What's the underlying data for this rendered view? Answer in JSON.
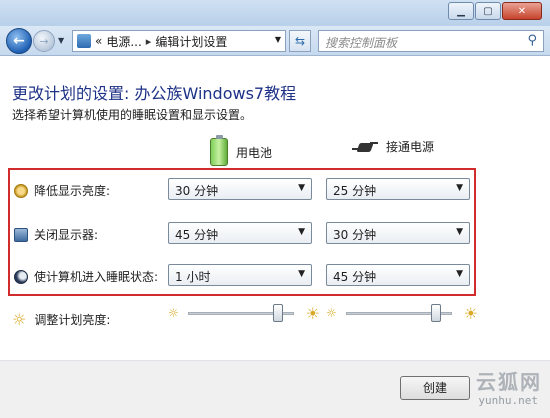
{
  "nav": {
    "breadcrumb_prefix": "«",
    "breadcrumb_1": "电源...",
    "breadcrumb_sep": "▸",
    "breadcrumb_2": "编辑计划设置",
    "search_placeholder": "搜索控制面板"
  },
  "main": {
    "title": "更改计划的设置: 办公族Windows7教程",
    "description": "选择希望计算机使用的睡眠设置和显示设置。",
    "col_battery": "用电池",
    "col_plugged": "接通电源",
    "rows": [
      {
        "label": "降低显示亮度:",
        "battery": "30 分钟",
        "plugged": "25 分钟"
      },
      {
        "label": "关闭显示器:",
        "battery": "45 分钟",
        "plugged": "30 分钟"
      },
      {
        "label": "使计算机进入睡眠状态:",
        "battery": "1 小时",
        "plugged": "45 分钟"
      }
    ],
    "brightness_label": "调整计划亮度:",
    "brightness_battery": 0.85,
    "brightness_plugged": 0.85
  },
  "footer": {
    "create_label": "创建"
  },
  "watermark": {
    "text": "云狐网",
    "url": "yunhu.net"
  }
}
